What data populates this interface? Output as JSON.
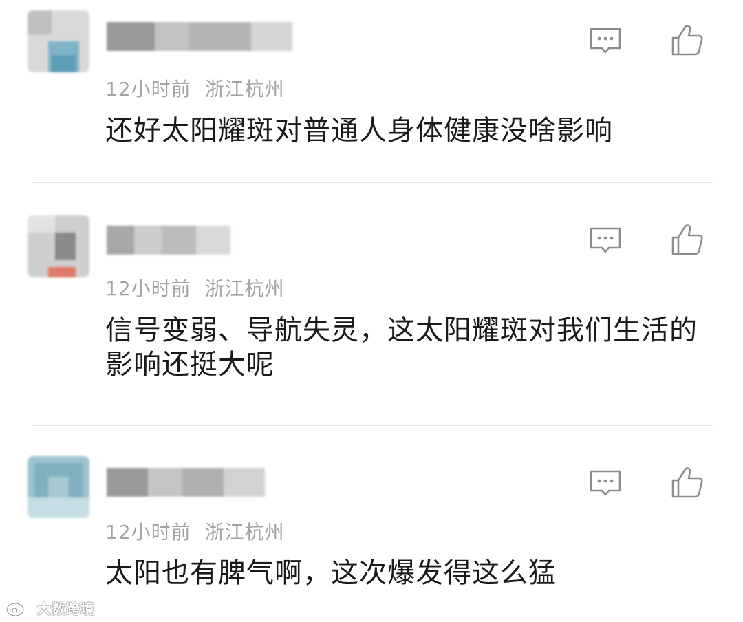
{
  "comments": [
    {
      "time": "12小时前",
      "location": "浙江杭州",
      "text": "还好太阳耀斑对普通人身体健康没啥影响",
      "avatar_colors": [
        "#d9d9d9",
        "#7fb3c8",
        "#bfbfbf",
        "#5e9fb8"
      ],
      "username_colors": [
        "#9a9a9a",
        "#c2c2c2",
        "#b5b5b5",
        "#d6d6d6"
      ]
    },
    {
      "time": "12小时前",
      "location": "浙江杭州",
      "text": "信号变弱、导航失灵，这太阳耀斑对我们生活的影响还挺大呢",
      "avatar_colors": [
        "#cfcfcf",
        "#8a8a8a",
        "#e2e2e2",
        "#e07a6a"
      ],
      "username_colors": [
        "#a8a8a8",
        "#cdcdcd",
        "#bcbcbc",
        "#d9d9d9"
      ]
    },
    {
      "time": "12小时前",
      "location": "浙江杭州",
      "text": "太阳也有脾气啊，这次爆发得这么猛",
      "avatar_colors": [
        "#9cc4cf",
        "#7fb0bf",
        "#c6dde3",
        "#a6c9d2"
      ],
      "username_colors": [
        "#999999",
        "#c4c4c4",
        "#b0b0b0",
        "#d2d2d2"
      ]
    }
  ],
  "icons": {
    "reply": "comment-bubble-icon",
    "like": "thumbs-up-icon",
    "watermark_logo": "weibo-logo-icon"
  },
  "watermark": {
    "text": "大数跨境"
  },
  "colors": {
    "meta_text": "#a3a3a3",
    "body_text": "#1a1a1a",
    "icon_stroke": "#8c8c8c",
    "divider": "#e4e4e4"
  }
}
